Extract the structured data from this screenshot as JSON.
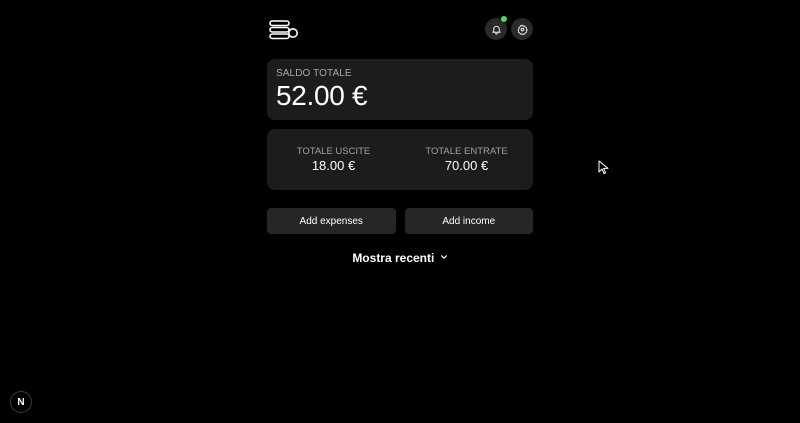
{
  "header": {
    "logo_icon": "stacked-coins-icon",
    "notification_icon": "bell-icon",
    "settings_icon": "gear-icon",
    "notification_dot_color": "#4cd964"
  },
  "balance": {
    "label": "SALDO TOTALE",
    "value": "52.00 €"
  },
  "totals": {
    "outgoing_label": "TOTALE USCITE",
    "outgoing_value": "18.00 €",
    "incoming_label": "TOTALE ENTRATE",
    "incoming_value": "70.00 €"
  },
  "actions": {
    "add_expenses_label": "Add expenses",
    "add_income_label": "Add income"
  },
  "recent": {
    "label": "Mostra recenti",
    "icon": "chevron-down-icon"
  },
  "dev_badge": {
    "label": "N"
  }
}
